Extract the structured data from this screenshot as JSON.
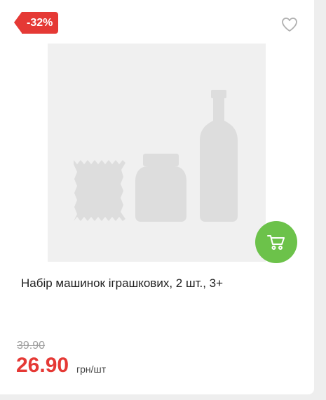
{
  "product": {
    "discount_badge": "-32%",
    "title": "Набір машинок іграшкових, 2 шт., 3+",
    "old_price": "39.90",
    "new_price": "26.90",
    "unit": "грн/шт"
  },
  "icons": {
    "wishlist": "heart-outline-icon",
    "cart": "shopping-cart-icon",
    "placeholder": "product-placeholder-icon"
  },
  "colors": {
    "badge": "#e53935",
    "cart_button": "#6cc24a",
    "price": "#e53935",
    "placeholder_bg": "#f0f0f0",
    "placeholder_shapes": "#dddddd"
  }
}
